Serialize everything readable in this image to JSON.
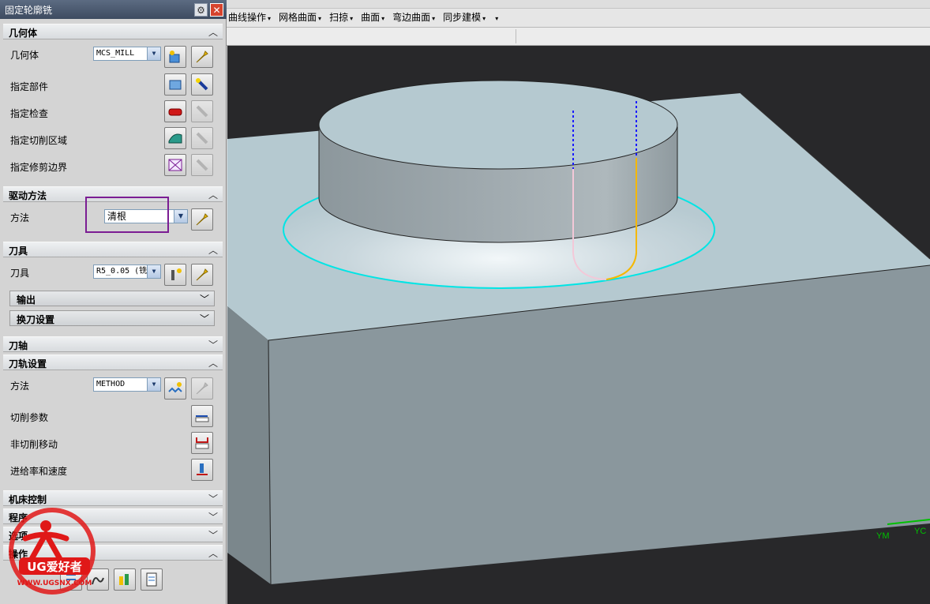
{
  "dialog": {
    "title": "固定轮廓铣",
    "sections": {
      "geometry": {
        "header": "几何体",
        "geometry_label": "几何体",
        "geometry_value": "MCS_MILL",
        "part_label": "指定部件",
        "check_label": "指定检查",
        "cut_area_label": "指定切削区域",
        "trim_label": "指定修剪边界"
      },
      "drive": {
        "header": "驱动方法",
        "method_label": "方法",
        "method_value": "清根"
      },
      "tool": {
        "header": "刀具",
        "tool_label": "刀具",
        "tool_value": "R5_0.05 (铣",
        "output": "输出",
        "tool_change": "换刀设置"
      },
      "axis": {
        "header": "刀轴"
      },
      "path": {
        "header": "刀轨设置",
        "method_label": "方法",
        "method_value": "METHOD",
        "cut_params": "切削参数",
        "non_cut": "非切削移动",
        "feeds": "进给率和速度"
      },
      "machine": {
        "header": "机床控制"
      },
      "program": {
        "header": "程序"
      },
      "options": {
        "header": "选项"
      },
      "actions": {
        "header": "操作"
      }
    }
  },
  "menubar": {
    "items": [
      "曲线操作",
      "网格曲面",
      "扫掠",
      "曲面",
      "弯边曲面",
      "同步建模"
    ]
  },
  "viewport": {
    "axis_labels": {
      "ym": "YM",
      "yc": "YC"
    }
  },
  "watermark": {
    "brand": "UG爱好者",
    "url": "WWW.UGSNX.COM"
  },
  "colors": {
    "accent": "#7b1d93",
    "boundary": "#00e5e5",
    "tool_path": "#f5b800",
    "axis_dash": "#1a1aff"
  }
}
